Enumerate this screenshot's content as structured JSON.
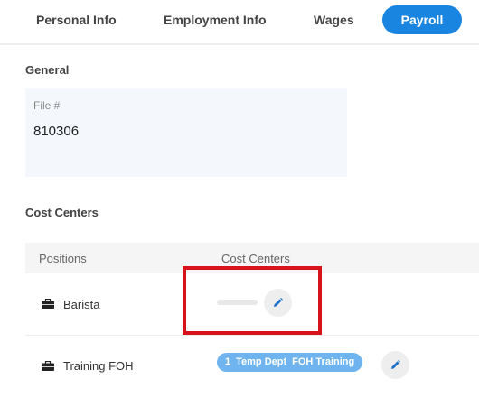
{
  "tabs": [
    {
      "label": "Personal Info"
    },
    {
      "label": "Employment Info"
    },
    {
      "label": "Wages"
    },
    {
      "label": "Payroll",
      "active": true
    }
  ],
  "general": {
    "title": "General",
    "file_label": "File #",
    "file_value": "810306"
  },
  "cost_centers": {
    "title": "Cost Centers",
    "columns": [
      "Positions",
      "Cost Centers"
    ],
    "rows": [
      {
        "position": "Barista",
        "cost_center": null
      },
      {
        "position": "Training FOH",
        "cost_center": {
          "count": "1",
          "dept": "Temp Dept",
          "name": "FOH Training"
        }
      }
    ]
  },
  "colors": {
    "accent": "#1a85e0",
    "chip": "#6fb4ef",
    "highlight": "#d6131a"
  },
  "icons": [
    "briefcase-icon",
    "pencil-icon"
  ]
}
